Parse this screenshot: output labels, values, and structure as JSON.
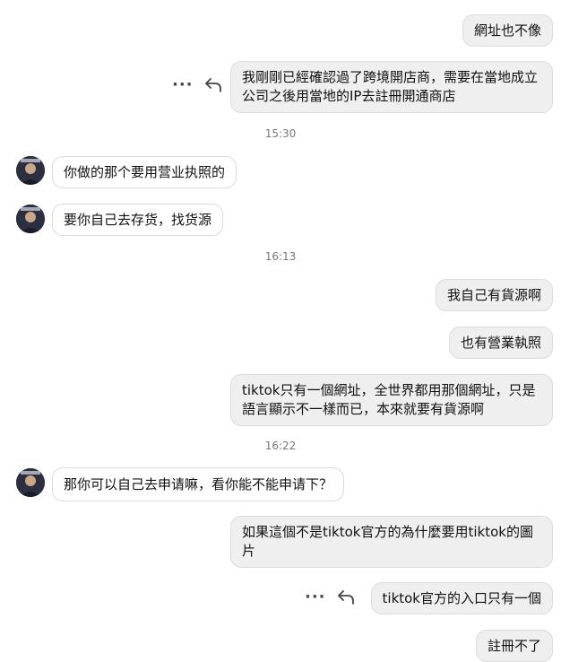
{
  "messages": [
    {
      "text": "網址也不像"
    },
    {
      "text": "我剛剛已經確認過了跨境開店商，需要在當地成立公司之後用當地的IP去註冊開通商店"
    },
    {
      "text": "你做的那个要用营业执照的"
    },
    {
      "text": "要你自己去存货，找货源"
    },
    {
      "text": "我自己有貨源啊"
    },
    {
      "text": "也有營業執照"
    },
    {
      "text": "tiktok只有一個網址，全世界都用那個網址，只是語言顯示不一樣而已，本來就要有貨源啊"
    },
    {
      "text": "那你可以自己去申请嘛，看你能不能申请下？"
    },
    {
      "text": "如果這個不是tiktok官方的為什麼要用tiktok的圖片"
    },
    {
      "text": "tiktok官方的入口只有一個"
    },
    {
      "text": "註冊不了"
    }
  ],
  "timestamps": [
    "15:30",
    "16:13",
    "16:22"
  ],
  "icons": {
    "more": "ellipsis-icon",
    "reply": "reply-arrow-icon"
  },
  "colors": {
    "outgoing_bubble": "#efefef",
    "incoming_bubble": "#ffffff",
    "border": "#dcdcdc"
  }
}
